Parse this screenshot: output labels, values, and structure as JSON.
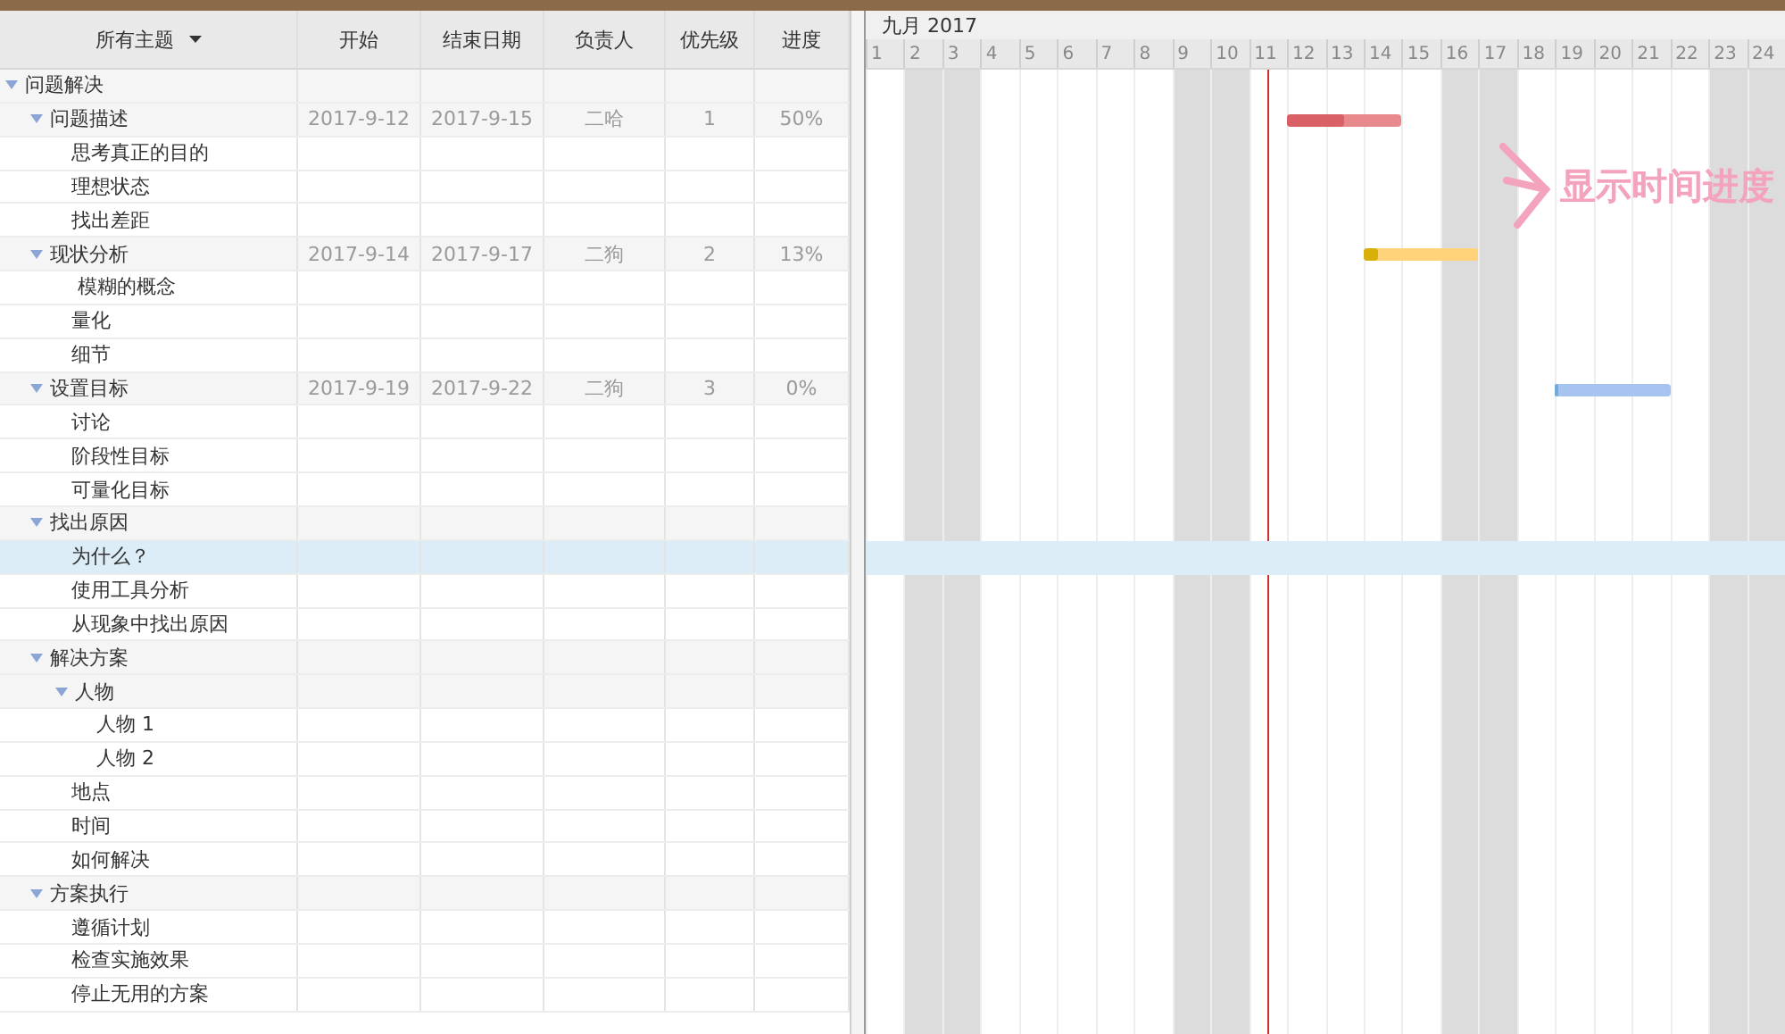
{
  "table": {
    "columns": [
      {
        "label": "所有主题",
        "kind": "menu"
      },
      {
        "label": "开始",
        "kind": "plain"
      },
      {
        "label": "结束日期",
        "kind": "plain"
      },
      {
        "label": "负责人",
        "kind": "plain"
      },
      {
        "label": "优先级",
        "kind": "plain"
      },
      {
        "label": "进度",
        "kind": "plain"
      }
    ],
    "rows": [
      {
        "label": "问题解决",
        "expanded": true,
        "selected": false,
        "children": [
          {
            "label": "问题描述",
            "expanded": true,
            "selected": false,
            "start": "2017-9-12",
            "end": "2017-9-15",
            "owner": "二哈",
            "priority": "1",
            "progress": "50%",
            "level": 0.5,
            "color": "#e88a8d",
            "children": [
              {
                "label": "思考真正的目的",
                "selected": false
              },
              {
                "label": "理想状态",
                "selected": false
              },
              {
                "label": "找出差距",
                "selected": false
              }
            ]
          },
          {
            "label": "现状分析",
            "expanded": true,
            "selected": false,
            "start": "2017-9-14",
            "end": "2017-9-17",
            "owner": "二狗",
            "priority": "2",
            "progress": "13%",
            "level": 0.13,
            "color": "#ffd37a",
            "children": [
              {
                "label": " 模糊的概念",
                "selected": false
              },
              {
                "label": "量化",
                "selected": false
              },
              {
                "label": "细节",
                "selected": false
              }
            ]
          },
          {
            "label": "设置目标",
            "expanded": true,
            "selected": false,
            "start": "2017-9-19",
            "end": "2017-9-22",
            "owner": "二狗",
            "priority": "3",
            "progress": "0%",
            "level": 0,
            "color": "#a7c4f0",
            "children": [
              {
                "label": "讨论",
                "selected": false
              },
              {
                "label": "阶段性目标",
                "selected": false
              },
              {
                "label": "可量化目标",
                "selected": false
              }
            ]
          },
          {
            "label": "找出原因",
            "expanded": true,
            "selected": false,
            "children": [
              {
                "label": "为什么？",
                "selected": true
              },
              {
                "label": "使用工具分析",
                "selected": false
              },
              {
                "label": "从现象中找出原因",
                "selected": false
              }
            ]
          },
          {
            "label": "解决方案",
            "expanded": true,
            "selected": false,
            "children": [
              {
                "label": "人物",
                "expanded": true,
                "selected": false,
                "children": [
                  {
                    "label": "人物 1",
                    "selected": false
                  },
                  {
                    "label": "人物 2",
                    "selected": false
                  }
                ]
              },
              {
                "label": "地点",
                "selected": false
              },
              {
                "label": "时间",
                "selected": false
              },
              {
                "label": "如何解决",
                "selected": false
              }
            ]
          },
          {
            "label": "方案执行",
            "expanded": true,
            "selected": false,
            "children": [
              {
                "label": "遵循计划",
                "selected": false
              },
              {
                "label": "检查实施效果",
                "selected": false
              },
              {
                "label": "停止无用的方案",
                "selected": false
              }
            ]
          }
        ]
      }
    ]
  },
  "gantt": {
    "month": "九月 2017",
    "days": [
      {
        "label": "1",
        "weekend": false,
        "today": false
      },
      {
        "label": "2",
        "weekend": true,
        "today": false
      },
      {
        "label": "3",
        "weekend": true,
        "today": false
      },
      {
        "label": "4",
        "weekend": false,
        "today": false
      },
      {
        "label": "5",
        "weekend": false,
        "today": false
      },
      {
        "label": "6",
        "weekend": false,
        "today": false
      },
      {
        "label": "7",
        "weekend": false,
        "today": false
      },
      {
        "label": "8",
        "weekend": false,
        "today": false
      },
      {
        "label": "9",
        "weekend": true,
        "today": false
      },
      {
        "label": "10",
        "weekend": true,
        "today": false
      },
      {
        "label": "11",
        "weekend": false,
        "today": true
      },
      {
        "label": "12",
        "weekend": false,
        "today": false
      },
      {
        "label": "13",
        "weekend": false,
        "today": false
      },
      {
        "label": "14",
        "weekend": false,
        "today": false
      },
      {
        "label": "15",
        "weekend": false,
        "today": false
      },
      {
        "label": "16",
        "weekend": true,
        "today": false
      },
      {
        "label": "17",
        "weekend": true,
        "today": false
      },
      {
        "label": "18",
        "weekend": false,
        "today": false
      },
      {
        "label": "19",
        "weekend": false,
        "today": false
      },
      {
        "label": "20",
        "weekend": false,
        "today": false
      },
      {
        "label": "21",
        "weekend": false,
        "today": false
      },
      {
        "label": "22",
        "weekend": false,
        "today": false
      },
      {
        "label": "23",
        "weekend": true,
        "today": false
      },
      {
        "label": "24",
        "weekend": true,
        "today": false
      }
    ]
  },
  "annotation": {
    "text": "显示时间进度"
  }
}
